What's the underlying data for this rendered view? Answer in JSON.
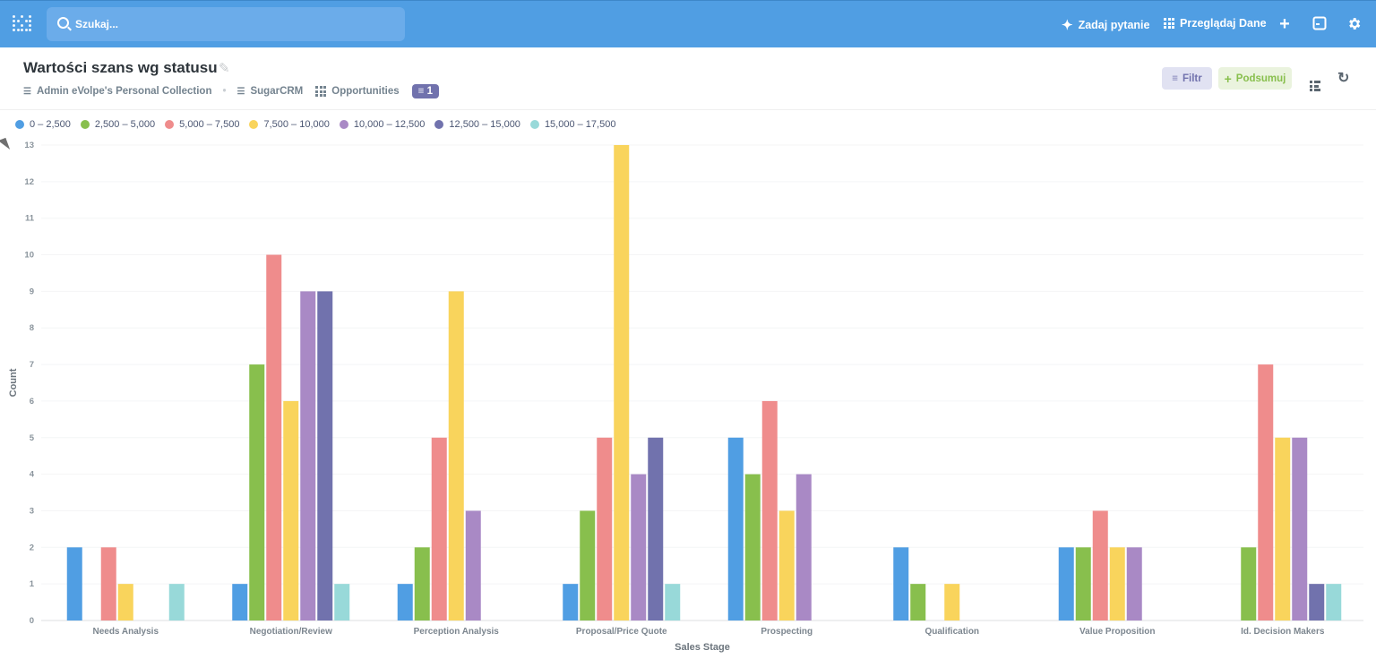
{
  "nav": {
    "search_placeholder": "Szukaj...",
    "ask_question": "Zadaj pytanie",
    "browse_data": "Przeglądaj Dane"
  },
  "header": {
    "title": "Wartości szans wg statusu",
    "breadcrumbs": [
      "Admin eVolpe's Personal Collection",
      "SugarCRM",
      "Opportunities"
    ],
    "filter_count": "1",
    "filter_button": "Filtr",
    "summarize_button": "Podsumuj"
  },
  "chart_data": {
    "type": "bar",
    "title": "Wartości szans wg statusu",
    "xlabel": "Sales Stage",
    "ylabel": "Count",
    "ylim": [
      0,
      13
    ],
    "yticks": [
      0,
      1,
      2,
      3,
      4,
      5,
      6,
      7,
      8,
      9,
      10,
      11,
      12,
      13
    ],
    "grid": true,
    "legend_position": "top-left",
    "categories": [
      "Needs Analysis",
      "Negotiation/Review",
      "Perception Analysis",
      "Proposal/Price Quote",
      "Prospecting",
      "Qualification",
      "Value Proposition",
      "Id. Decision Makers"
    ],
    "series": [
      {
        "name": "0 – 2,500",
        "color": "#509ee3",
        "values": [
          2,
          1,
          1,
          1,
          5,
          2,
          2,
          0
        ]
      },
      {
        "name": "2,500 – 5,000",
        "color": "#88bf4d",
        "values": [
          0,
          7,
          2,
          3,
          4,
          1,
          2,
          2
        ]
      },
      {
        "name": "5,000 – 7,500",
        "color": "#ef8c8c",
        "values": [
          2,
          10,
          5,
          5,
          6,
          0,
          3,
          7
        ]
      },
      {
        "name": "7,500 – 10,000",
        "color": "#f9d45c",
        "values": [
          1,
          6,
          9,
          13,
          3,
          1,
          2,
          5
        ]
      },
      {
        "name": "10,000 – 12,500",
        "color": "#a989c5",
        "values": [
          0,
          9,
          3,
          4,
          4,
          0,
          2,
          5
        ]
      },
      {
        "name": "12,500 – 15,000",
        "color": "#7172ad",
        "values": [
          0,
          9,
          0,
          5,
          0,
          0,
          0,
          1
        ]
      },
      {
        "name": "15,000 – 17,500",
        "color": "#98d9d9",
        "values": [
          1,
          1,
          0,
          1,
          0,
          0,
          0,
          1
        ]
      }
    ]
  }
}
